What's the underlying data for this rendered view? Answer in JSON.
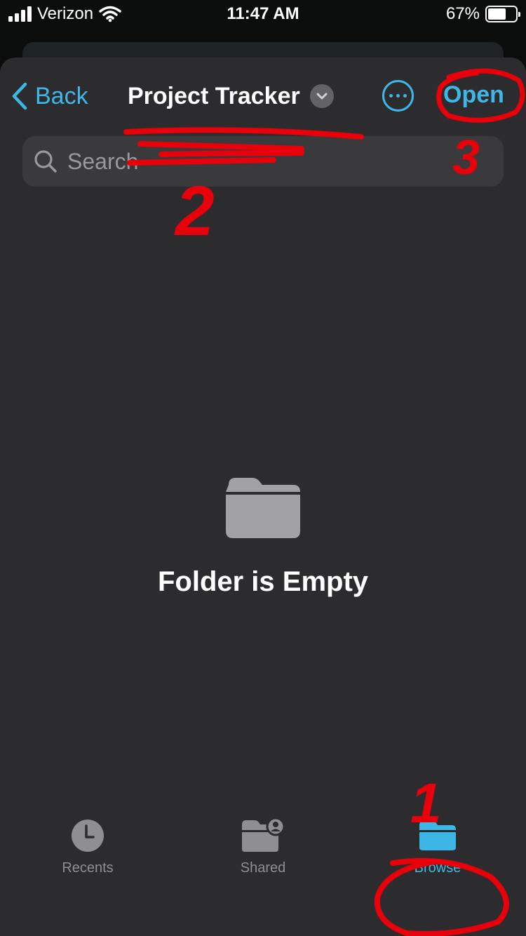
{
  "status_bar": {
    "carrier": "Verizon",
    "time": "11:47 AM",
    "battery": "67%",
    "battery_level": 0.67
  },
  "nav": {
    "back_label": "Back",
    "title": "Project Tracker",
    "open_label": "Open"
  },
  "search": {
    "placeholder": "Search"
  },
  "empty_state": {
    "message": "Folder is Empty"
  },
  "tabs": [
    {
      "label": "Recents",
      "icon": "clock-icon",
      "active": false
    },
    {
      "label": "Shared",
      "icon": "shared-folder-icon",
      "active": false
    },
    {
      "label": "Browse",
      "icon": "folder-icon",
      "active": true
    }
  ],
  "annotations": {
    "numbers": [
      "1",
      "2",
      "3"
    ],
    "color": "#e8000b"
  },
  "colors": {
    "accent": "#3fb7e6",
    "sheet_background": "#2c2c2e",
    "search_background": "#3a3a3c",
    "inactive_tab": "#8e8e93"
  }
}
